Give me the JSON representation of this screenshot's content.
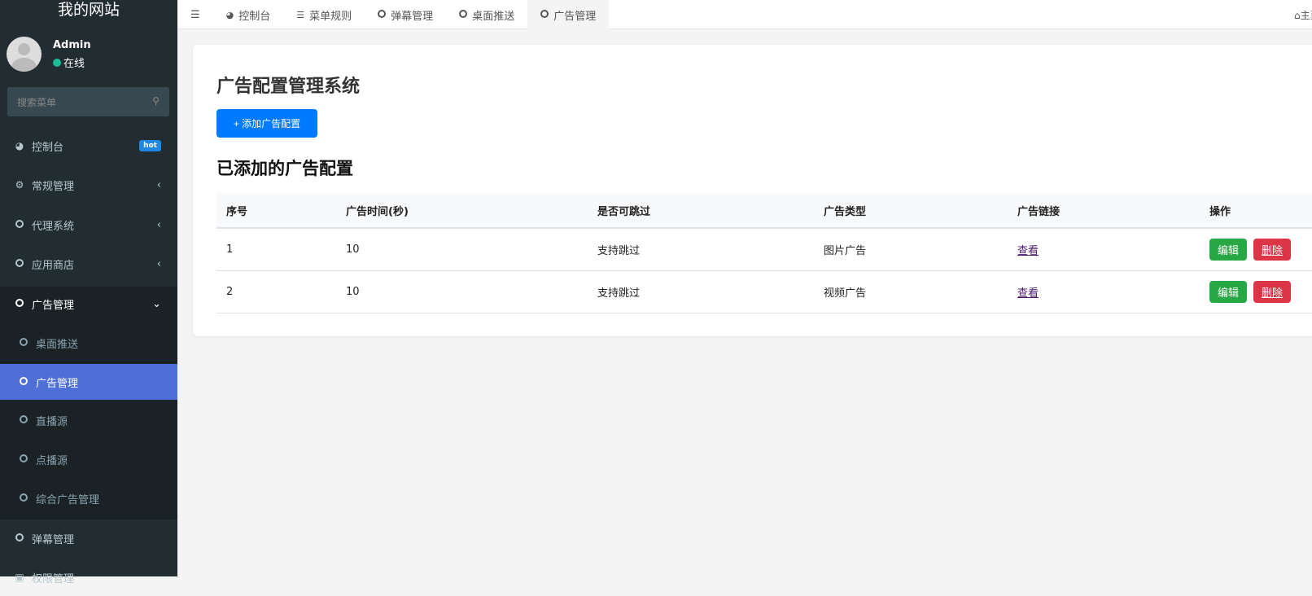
{
  "sidebar": {
    "site_title": "我的网站",
    "user_name": "Admin",
    "user_status": "在线",
    "search_placeholder": "搜索菜单",
    "items": [
      {
        "label": "控制台",
        "badge": "hot"
      },
      {
        "label": "常规管理"
      },
      {
        "label": "代理系统"
      },
      {
        "label": "应用商店"
      },
      {
        "label": "广告管理"
      },
      {
        "label": "弹幕管理"
      },
      {
        "label": "权限管理"
      }
    ],
    "sub_items": [
      {
        "label": "桌面推送"
      },
      {
        "label": "广告管理"
      },
      {
        "label": "直播源"
      },
      {
        "label": "点播源"
      },
      {
        "label": "综合广告管理"
      }
    ]
  },
  "topbar": {
    "tabs": [
      {
        "label": "控制台"
      },
      {
        "label": "菜单规则"
      },
      {
        "label": "弹幕管理"
      },
      {
        "label": "桌面推送"
      },
      {
        "label": "广告管理"
      }
    ],
    "home_label": "主页"
  },
  "main": {
    "title": "广告配置管理系统",
    "add_button": "+ 添加广告配置",
    "section_title": "已添加的广告配置",
    "columns": [
      "序号",
      "广告时间(秒)",
      "是否可跳过",
      "广告类型",
      "广告链接",
      "操作"
    ],
    "rows": [
      {
        "id": "1",
        "time": "10",
        "skip": "支持跳过",
        "type": "图片广告",
        "link": "查看"
      },
      {
        "id": "2",
        "time": "10",
        "skip": "支持跳过",
        "type": "视频广告",
        "link": "查看"
      }
    ],
    "edit_label": "编辑",
    "delete_label": "删除"
  }
}
